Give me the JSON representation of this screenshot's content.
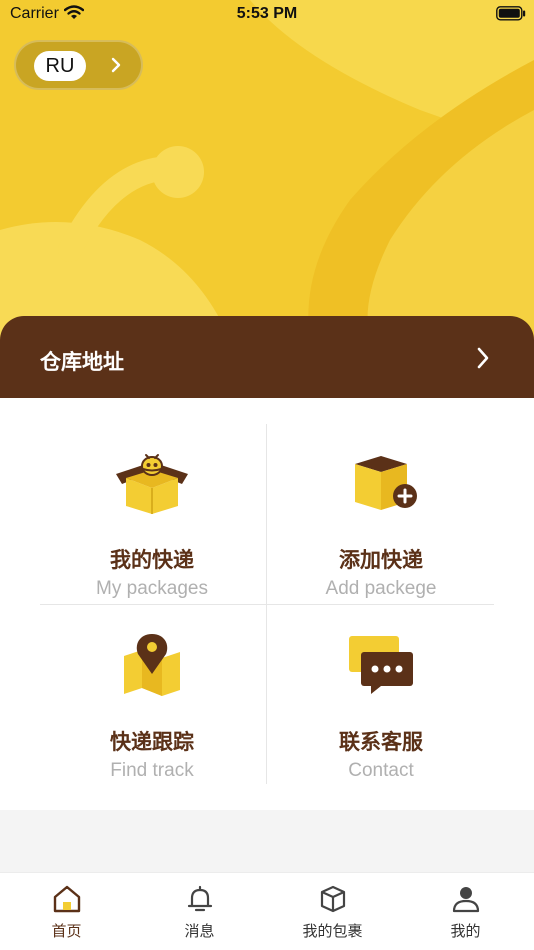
{
  "status_bar": {
    "carrier": "Carrier",
    "time": "5:53 PM"
  },
  "language": {
    "code": "RU"
  },
  "warehouse": {
    "label": "仓库地址"
  },
  "menu": [
    {
      "title": "我的快递",
      "subtitle": "My packages",
      "icon": "bee-box-icon"
    },
    {
      "title": "添加快递",
      "subtitle": "Add packege",
      "icon": "add-box-icon"
    },
    {
      "title": "快递跟踪",
      "subtitle": "Find track",
      "icon": "map-pin-icon"
    },
    {
      "title": "联系客服",
      "subtitle": "Contact",
      "icon": "chat-bubble-icon"
    }
  ],
  "tabs": [
    {
      "label": "首页",
      "icon": "home-icon",
      "active": true
    },
    {
      "label": "消息",
      "icon": "bell-icon"
    },
    {
      "label": "我的包裹",
      "icon": "package-icon"
    },
    {
      "label": "我的",
      "icon": "person-icon"
    }
  ],
  "colors": {
    "brand_yellow": "#f3cd33",
    "brand_brown": "#5b3118",
    "subtitle_gray": "#b0b0b0"
  }
}
